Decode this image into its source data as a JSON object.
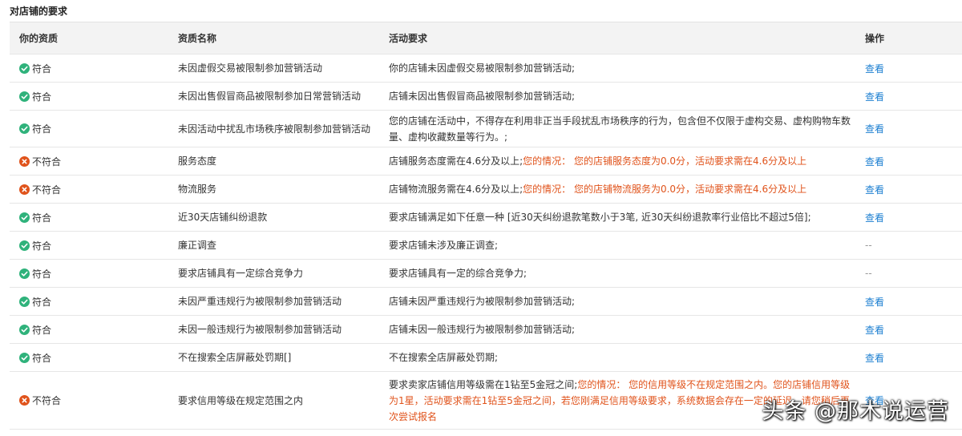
{
  "section_title": "对店铺的要求",
  "columns": {
    "qualification": "你的资质",
    "name": "资质名称",
    "requirement": "活动要求",
    "action": "操作"
  },
  "colors": {
    "pass": "#2fb27b",
    "fail": "#e0531b",
    "link": "#1c7fd1"
  },
  "rows": [
    {
      "status": "pass",
      "status_icon": "check-circle-icon",
      "qualification": "符合",
      "name": "未因虚假交易被限制参加营销活动",
      "requirement": "你的店铺未因虚假交易被限制参加营销活动;",
      "situation": "",
      "action": "查看"
    },
    {
      "status": "pass",
      "status_icon": "check-circle-icon",
      "qualification": "符合",
      "name": "未因出售假冒商品被限制参加日常营销活动",
      "requirement": "店铺未因出售假冒商品被限制参加营销活动;",
      "situation": "",
      "action": "查看"
    },
    {
      "status": "pass",
      "status_icon": "check-circle-icon",
      "qualification": "符合",
      "name": "未因活动中扰乱市场秩序被限制参加营销活动",
      "requirement": "您的店铺在活动中，不得存在利用非正当手段扰乱市场秩序的行为，包含但不仅限于虚构交易、虚构购物车数量、虚构收藏数量等行为。;",
      "situation": "",
      "action": "查看"
    },
    {
      "status": "fail",
      "status_icon": "cross-circle-icon",
      "qualification": "不符合",
      "name": "服务态度",
      "requirement": "店铺服务态度需在4.6分及以上;",
      "situation": "您的情况： 您的店铺服务态度为0.0分，活动要求需在4.6分及以上",
      "action": "查看"
    },
    {
      "status": "fail",
      "status_icon": "cross-circle-icon",
      "qualification": "不符合",
      "name": "物流服务",
      "requirement": "店铺物流服务需在4.6分及以上;",
      "situation": "您的情况： 您的店铺物流服务为0.0分，活动要求需在4.6分及以上",
      "action": "查看"
    },
    {
      "status": "pass",
      "status_icon": "check-circle-icon",
      "qualification": "符合",
      "name": "近30天店铺纠纷退款",
      "requirement": "要求店铺满足如下任意一种 [近30天纠纷退款笔数小于3笔, 近30天纠纷退款率行业倍比不超过5倍];",
      "situation": "",
      "action": "查看"
    },
    {
      "status": "pass",
      "status_icon": "check-circle-icon",
      "qualification": "符合",
      "name": "廉正调查",
      "requirement": "要求店铺未涉及廉正调查;",
      "situation": "",
      "action": "--"
    },
    {
      "status": "pass",
      "status_icon": "check-circle-icon",
      "qualification": "符合",
      "name": "要求店铺具有一定综合竞争力",
      "requirement": "要求店铺具有一定的综合竞争力;",
      "situation": "",
      "action": "--"
    },
    {
      "status": "pass",
      "status_icon": "check-circle-icon",
      "qualification": "符合",
      "name": "未因严重违规行为被限制参加营销活动",
      "requirement": "店铺未因严重违规行为被限制参加营销活动;",
      "situation": "",
      "action": "查看"
    },
    {
      "status": "pass",
      "status_icon": "check-circle-icon",
      "qualification": "符合",
      "name": "未因一般违规行为被限制参加营销活动",
      "requirement": "店铺未因一般违规行为被限制参加营销活动;",
      "situation": "",
      "action": "查看"
    },
    {
      "status": "pass",
      "status_icon": "check-circle-icon",
      "qualification": "符合",
      "name": "不在搜索全店屏蔽处罚期[]",
      "requirement": "不在搜索全店屏蔽处罚期;",
      "situation": "",
      "action": "查看"
    },
    {
      "status": "fail",
      "status_icon": "cross-circle-icon",
      "qualification": "不符合",
      "name": "要求信用等级在规定范围之内",
      "requirement": "要求卖家店铺信用等级需在1钻至5金冠之间;",
      "situation": "您的情况： 您的信用等级不在规定范围之内。您的店铺信用等级为1星，活动要求需在1钻至5金冠之间，若您刚满足信用等级要求，系统数据会存在一定的延迟，请您稍后再次尝试报名",
      "action": "查看"
    }
  ],
  "watermark": "头条 @那木说运营"
}
